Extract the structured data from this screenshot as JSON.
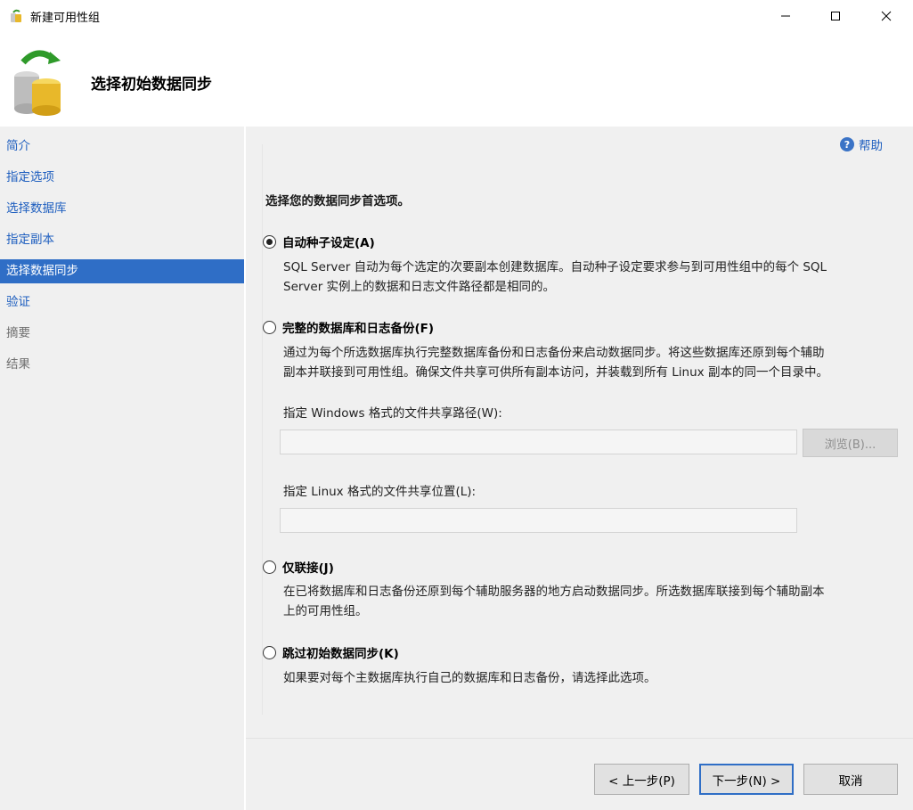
{
  "window": {
    "title": "新建可用性组",
    "minimize_glyph": "—",
    "maximize_glyph": "☐",
    "close_glyph": "✕"
  },
  "header": {
    "page_title": "选择初始数据同步"
  },
  "sidebar": {
    "items": [
      {
        "label": "简介",
        "state": "link"
      },
      {
        "label": "指定选项",
        "state": "link"
      },
      {
        "label": "选择数据库",
        "state": "link"
      },
      {
        "label": "指定副本",
        "state": "link"
      },
      {
        "label": "选择数据同步",
        "state": "active"
      },
      {
        "label": "验证",
        "state": "link"
      },
      {
        "label": "摘要",
        "state": "disabled"
      },
      {
        "label": "结果",
        "state": "disabled"
      }
    ]
  },
  "help": {
    "label": "帮助",
    "icon_glyph": "?"
  },
  "main": {
    "prompt": "选择您的数据同步首选项。",
    "options": [
      {
        "label": "自动种子设定(A)",
        "checked": true,
        "description": [
          "SQL Server 自动为每个选定的次要副本创建数据库。自动种子设定要求参与到可用性组中的每个 SQL",
          "Server 实例上的数据和日志文件路径都是相同的。"
        ]
      },
      {
        "label": "完整的数据库和日志备份(F)",
        "checked": false,
        "description": [
          "通过为每个所选数据库执行完整数据库备份和日志备份来启动数据同步。将这些数据库还原到每个辅助",
          "副本并联接到可用性组。确保文件共享可供所有副本访问，并装载到所有 Linux 副本的同一个目录中。"
        ]
      },
      {
        "label": "仅联接(J)",
        "checked": false,
        "description": [
          "在已将数据库和日志备份还原到每个辅助服务器的地方启动数据同步。所选数据库联接到每个辅助副本",
          "上的可用性组。"
        ]
      },
      {
        "label": "跳过初始数据同步(K)",
        "checked": false,
        "description": [
          "如果要对每个主数据库执行自己的数据库和日志备份，请选择此选项。"
        ]
      }
    ],
    "windows_path_label": "指定 Windows 格式的文件共享路径(W):",
    "windows_path_value": "",
    "browse_label": "浏览(B)...",
    "linux_path_label": "指定 Linux 格式的文件共享位置(L):",
    "linux_path_value": ""
  },
  "footer": {
    "prev_label": "< 上一步(P)",
    "next_label": "下一步(N) >",
    "cancel_label": "取消"
  },
  "colors": {
    "accent": "#2f6ec6",
    "link": "#1f5fbf",
    "panel_bg": "#f0f0f0"
  }
}
